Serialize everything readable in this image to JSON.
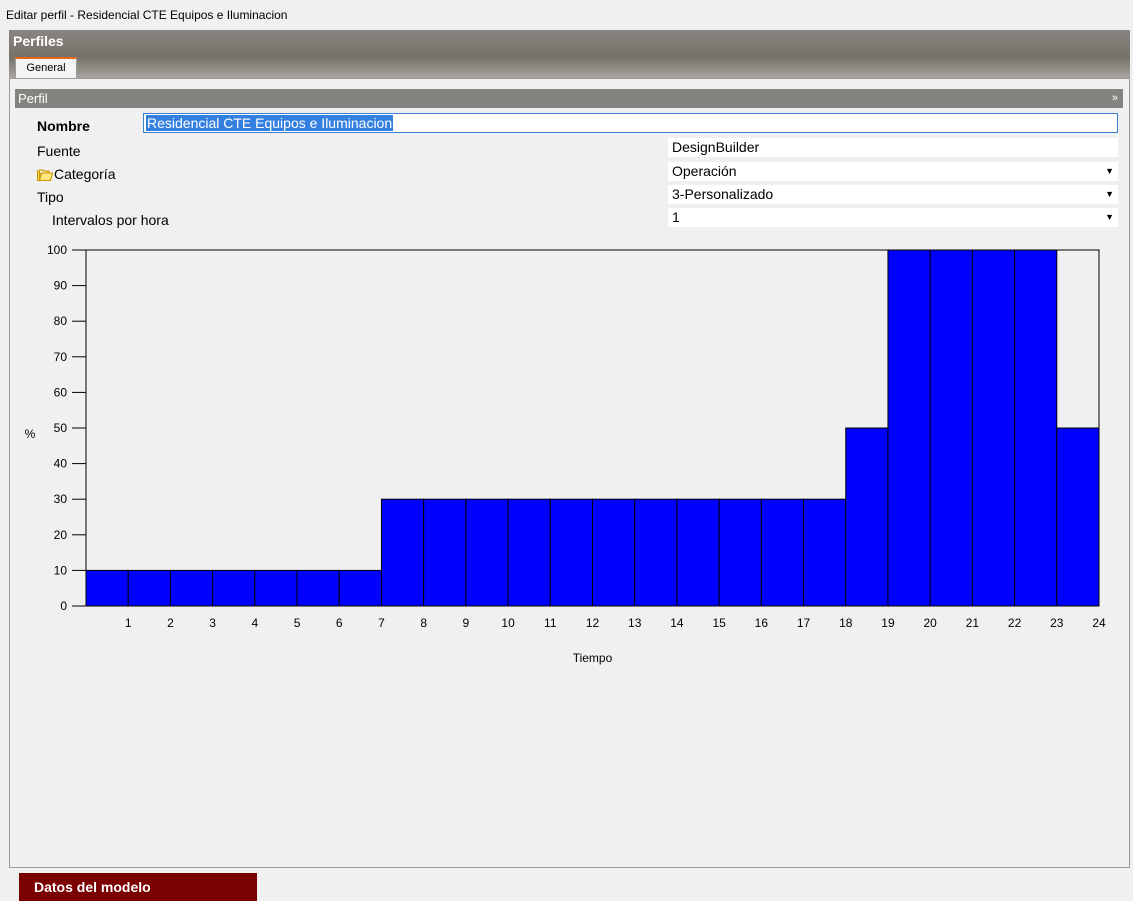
{
  "window": {
    "title": "Editar perfil - Residencial CTE Equipos e Iluminacion"
  },
  "header": {
    "title": "Perfiles",
    "tabs": [
      {
        "label": "General",
        "active": true
      }
    ]
  },
  "section": {
    "title": "Perfil",
    "chevron": "»"
  },
  "form": {
    "nombre_label": "Nombre",
    "nombre_value": "Residencial CTE Equipos e Iluminacion",
    "fuente_label": "Fuente",
    "fuente_value": "DesignBuilder",
    "categoria_label": "Categoría",
    "categoria_value": "Operación",
    "tipo_label": "Tipo",
    "tipo_value": "3-Personalizado",
    "intervalos_label": "Intervalos por hora",
    "intervalos_value": "1"
  },
  "icons": {
    "folder": "folder-icon",
    "dropdown": "chevron-down-icon"
  },
  "colors": {
    "bar_fill": "#0000ff",
    "header_bg": "#7a756f",
    "tab_accent": "#e5691d",
    "footer_btn": "#7b0000",
    "selection": "#3380e0"
  },
  "chart_data": {
    "type": "bar",
    "x": [
      1,
      2,
      3,
      4,
      5,
      6,
      7,
      8,
      9,
      10,
      11,
      12,
      13,
      14,
      15,
      16,
      17,
      18,
      19,
      20,
      21,
      22,
      23,
      24
    ],
    "values": [
      10,
      10,
      10,
      10,
      10,
      10,
      10,
      30,
      30,
      30,
      30,
      30,
      30,
      30,
      30,
      30,
      30,
      30,
      50,
      100,
      100,
      100,
      100,
      50
    ],
    "xlabel": "Tiempo",
    "ylabel": "%",
    "ylim": [
      0,
      100
    ],
    "yticks": [
      0,
      10,
      20,
      30,
      40,
      50,
      60,
      70,
      80,
      90,
      100
    ],
    "xtick_labels": [
      "1",
      "2",
      "3",
      "4",
      "5",
      "6",
      "7",
      "8",
      "9",
      "10",
      "11",
      "12",
      "13",
      "14",
      "15",
      "16",
      "17",
      "18",
      "19",
      "20",
      "21",
      "22",
      "23",
      "24"
    ]
  },
  "footer": {
    "button_label": "Datos del modelo"
  }
}
